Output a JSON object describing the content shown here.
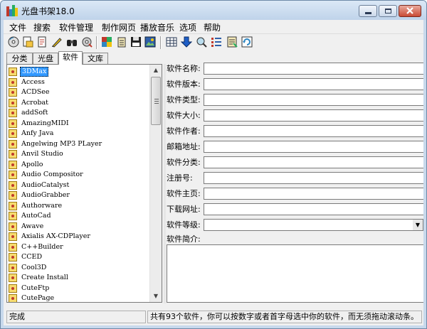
{
  "window": {
    "title": "光盘书架18.0"
  },
  "menu": [
    "文件",
    "搜索",
    "软件管理",
    "制作网页",
    "播放音乐",
    "选项",
    "帮助"
  ],
  "toolbar_icons": [
    "cd-icon",
    "open-folder-icon",
    "new-file-icon",
    "edit-pencil-icon",
    "binoculars-icon",
    "cd-burn-icon",
    "color-palette-icon",
    "notepad-icon",
    "save-disk-icon",
    "image-icon",
    "table-icon",
    "down-arrow-icon",
    "find-icon",
    "list-icon",
    "properties-icon",
    "refresh-icon"
  ],
  "tabs": [
    "分类",
    "光盘",
    "软件",
    "文库"
  ],
  "software_list": [
    "3DMax",
    "Access",
    "ACDSee",
    "Acrobat",
    "addSoft",
    "AmazingMIDI",
    "Anfy Java",
    "Angelwing MP3 PLayer",
    "Anvil Studio",
    "Apollo",
    "Audio Compositor",
    "AudioCatalyst",
    "AudioGrabber",
    "Authorware",
    "AutoCad",
    "Awave",
    "Axialis AX-CDPlayer",
    "C++Builder",
    "CCED",
    "Cool3D",
    "Create Install",
    "CuteFtp",
    "CutePage"
  ],
  "selected_item": "3DMax",
  "form": {
    "fields": [
      "软件名称:",
      "软件版本:",
      "软件类型:",
      "软件大小:",
      "软件作者:",
      "邮箱地址:",
      "软件分类:",
      "注册号:",
      "软件主页:",
      "下载网址:"
    ],
    "level_label": "软件等级:",
    "desc_label": "软件简介:"
  },
  "status": {
    "left": "完成",
    "right": "共有93个软件，你可以按数字或者首字母选中你的软件，而无须拖动滚动条。"
  },
  "colors": {
    "selection": "#3399ff",
    "title_bar": "#c8d9ec"
  }
}
